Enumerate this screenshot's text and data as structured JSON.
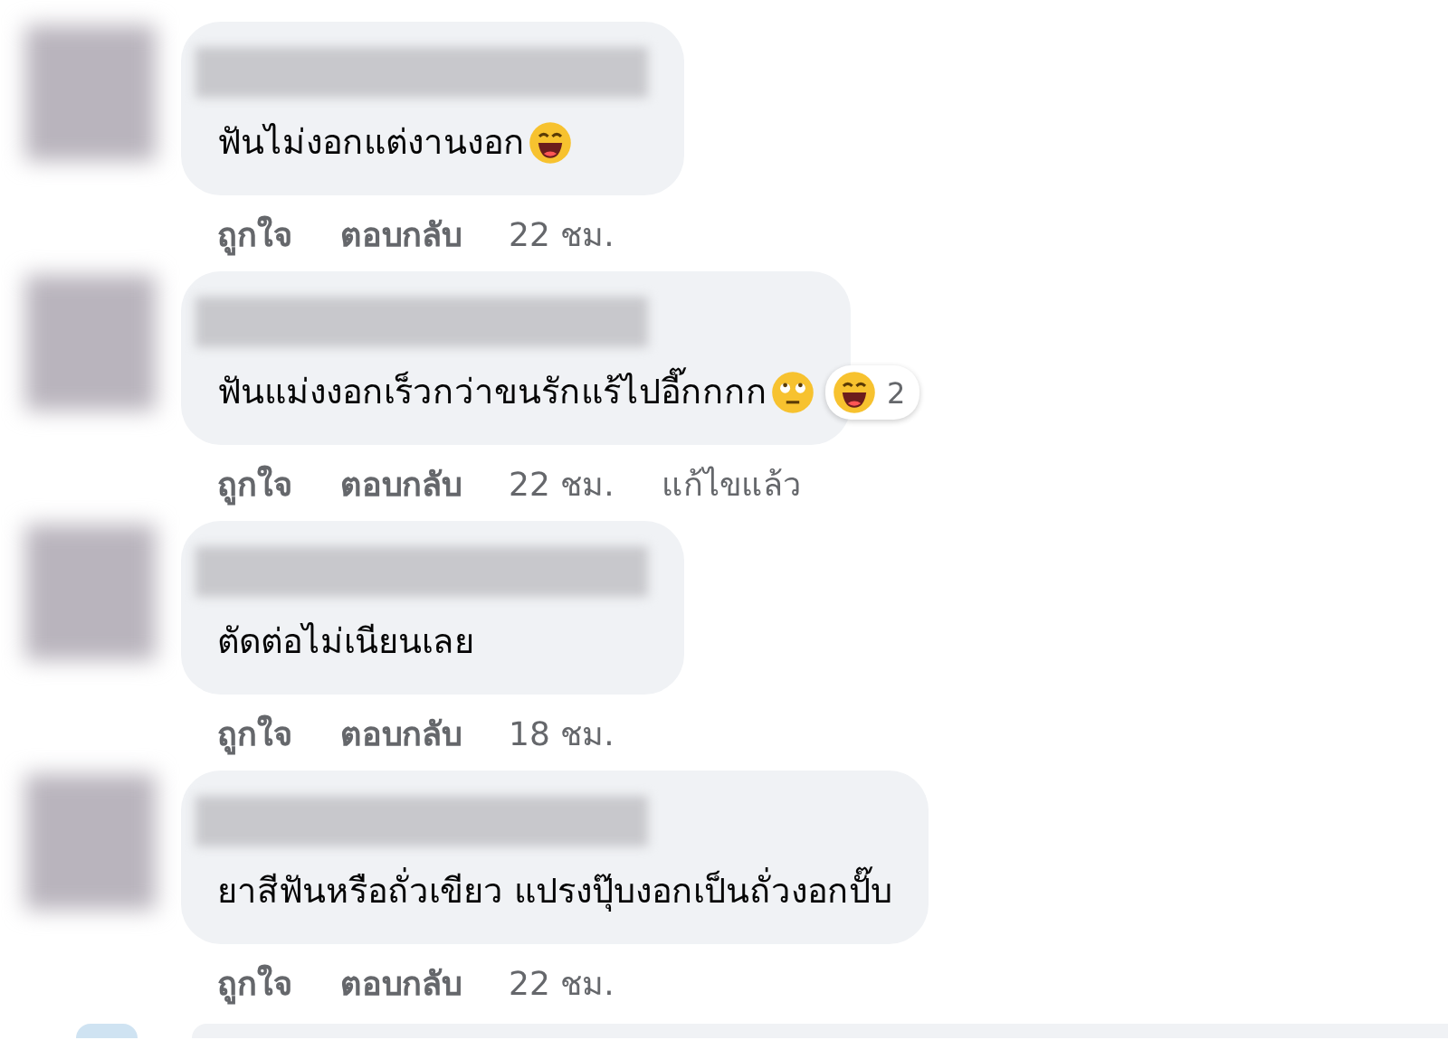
{
  "comments": [
    {
      "text": "ฟันไม่งอกแต่งานงอก",
      "emoji": {
        "kind": "laughing"
      },
      "actions": [
        "ถูกใจ",
        "ตอบกลับ",
        "22 ชม."
      ]
    },
    {
      "text": "ฟันแม่งงอกเร็วกว่าขนรักแร้ไปอี๊กกกก",
      "emoji": {
        "kind": "rolling-eyes"
      },
      "reaction": {
        "emoji": {
          "kind": "laughing"
        },
        "count": "2"
      },
      "actions": [
        "ถูกใจ",
        "ตอบกลับ",
        "22 ชม.",
        "แก้ไขแล้ว"
      ]
    },
    {
      "text": "ตัดต่อไม่เนียนเลย",
      "actions": [
        "ถูกใจ",
        "ตอบกลับ",
        "18 ชม."
      ]
    },
    {
      "text": "ยาสีฟันหรือถั่วเขียว แปรงปุ๊บงอกเป็นถั่วงอกปั๊บ",
      "actions": [
        "ถูกใจ",
        "ตอบกลับ",
        "22 ชม."
      ]
    }
  ]
}
